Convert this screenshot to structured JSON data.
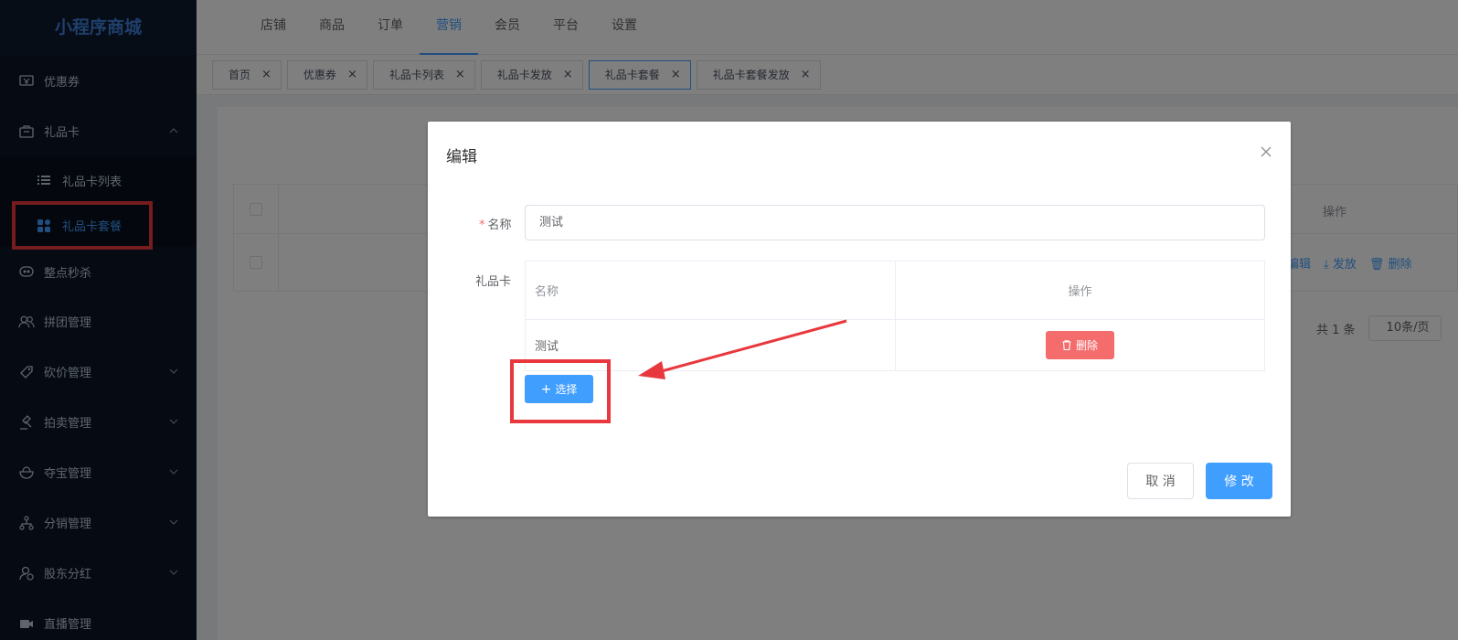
{
  "app": {
    "brand": "小程序商城"
  },
  "sidebar": {
    "items": [
      {
        "label": "优惠券",
        "icon": "coupon-icon"
      },
      {
        "label": "礼品卡",
        "icon": "gift-card-icon",
        "expanded": true,
        "children": [
          {
            "label": "礼品卡列表",
            "icon": "list-icon"
          },
          {
            "label": "礼品卡套餐",
            "icon": "grid-icon",
            "active": true
          }
        ]
      },
      {
        "label": "整点秒杀",
        "icon": "flash-sale-icon"
      },
      {
        "label": "拼团管理",
        "icon": "group-icon"
      },
      {
        "label": "砍价管理",
        "icon": "bargain-icon"
      },
      {
        "label": "拍卖管理",
        "icon": "auction-icon"
      },
      {
        "label": "夺宝管理",
        "icon": "treasure-icon"
      },
      {
        "label": "分销管理",
        "icon": "distribution-icon"
      },
      {
        "label": "股东分红",
        "icon": "shareholder-icon"
      },
      {
        "label": "直播管理",
        "icon": "live-icon"
      }
    ]
  },
  "topnav": {
    "tabs": [
      "店铺",
      "商品",
      "订单",
      "营销",
      "会员",
      "平台",
      "设置"
    ],
    "active": "营销"
  },
  "tagbar": {
    "tags": [
      "首页",
      "优惠券",
      "礼品卡列表",
      "礼品卡发放",
      "礼品卡套餐",
      "礼品卡套餐发放"
    ],
    "active": "礼品卡套餐"
  },
  "background": {
    "ops_header": "操作",
    "ops": [
      "编辑",
      "发放",
      "删除"
    ],
    "pager_total": "共 1 条",
    "pager_size": "10条/页"
  },
  "dialog": {
    "title": "编辑",
    "name_label": "名称",
    "name_value": "测试",
    "giftcard_label": "礼品卡",
    "table_headers": [
      "名称",
      "操作"
    ],
    "rows": [
      {
        "name": "测试"
      }
    ],
    "delete_label": "删除",
    "select_label": "选择",
    "cancel_label": "取 消",
    "confirm_label": "修 改"
  },
  "colors": {
    "primary": "#409eff",
    "danger": "#f56c6c",
    "sidebar_bg": "#0c1627",
    "highlight": "#e8383d"
  }
}
